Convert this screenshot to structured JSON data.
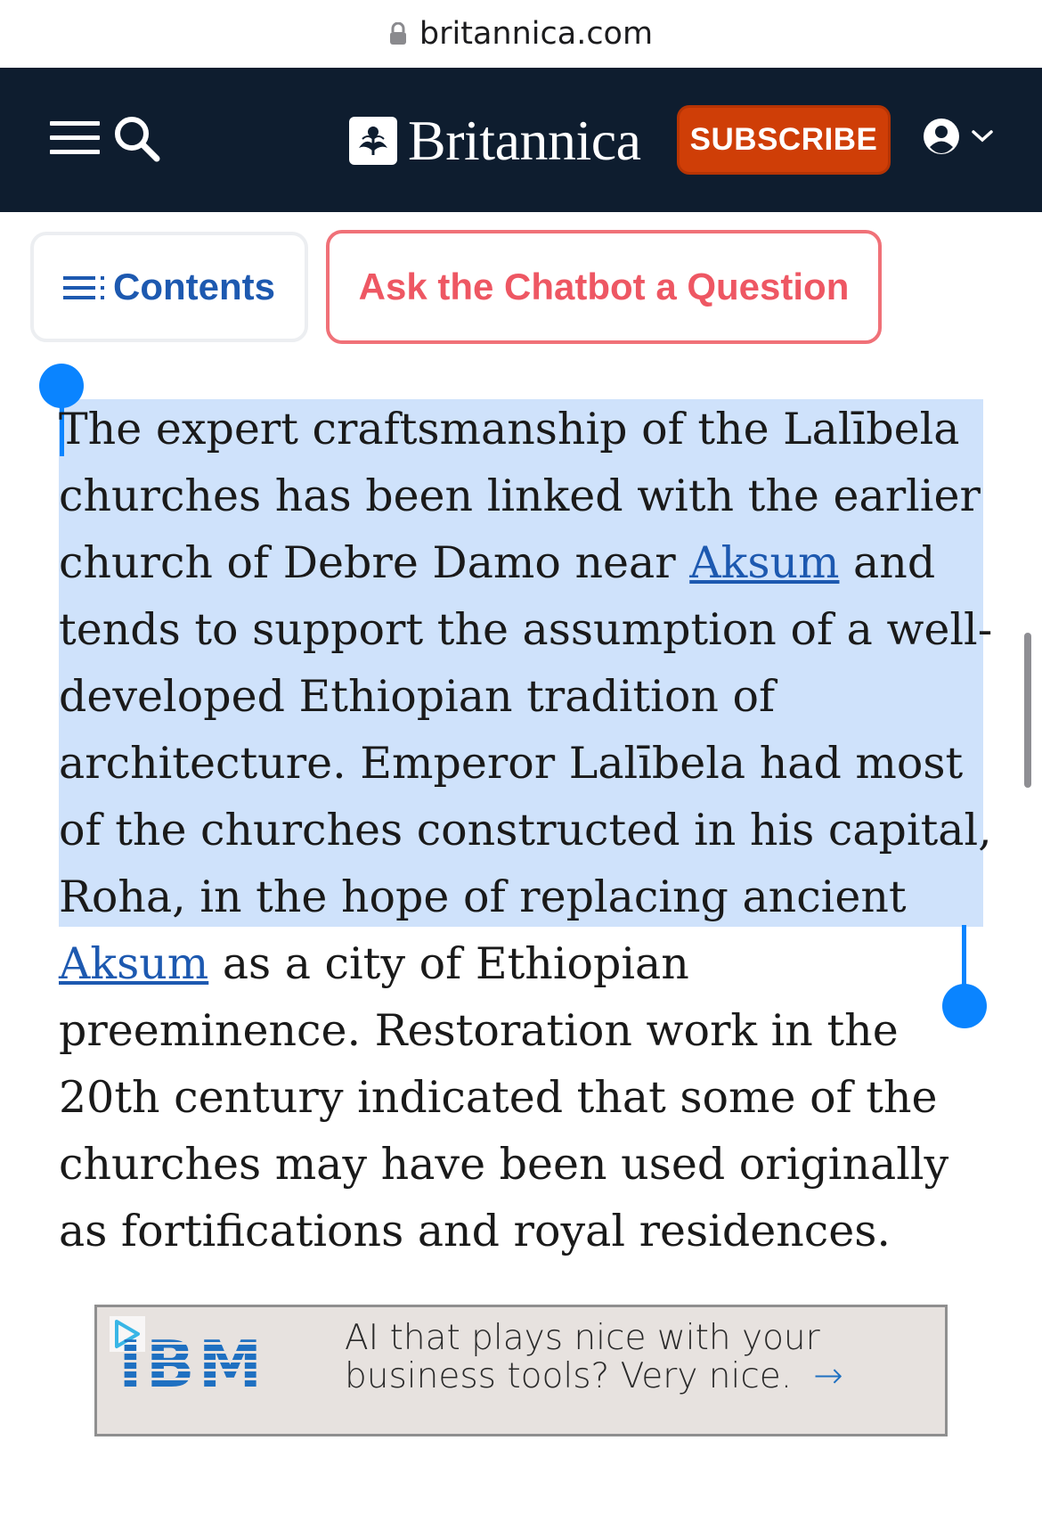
{
  "browser": {
    "url": "britannica.com"
  },
  "header": {
    "brand": "Britannica",
    "subscribe_label": "SUBSCRIBE"
  },
  "toolbar": {
    "contents_label": "Contents",
    "chatbot_label": "Ask the Chatbot a Question"
  },
  "article": {
    "p1_a": "The expert craftsmanship of the Lalībela churches has been linked with the earlier church of Debre Damo near ",
    "link1": "Aksum",
    "p1_b": " and tends to support the assumption of a well-developed Ethiopian tradition of architecture. Emperor Lalībela had most of the churches constructed in his capital, Roha, in the hope of replacing ancient ",
    "link2": "Aksum",
    "p1_c": " as a city of Ethiopian preeminence.",
    "p1_d": " Restoration work in the 20th century indicated that some of the churches may have been used originally as fortifications and royal residences."
  },
  "ad": {
    "brand": "IBM",
    "text": "AI that plays nice with your business tools? Very nice."
  },
  "colors": {
    "header_bg": "#0e1d2f",
    "subscribe_bg": "#cf3e07",
    "link": "#1d59b0",
    "chatbot_accent": "#ee5763",
    "selection": "#c5dcf7"
  },
  "icons": [
    "lock-icon",
    "menu-icon",
    "search-icon",
    "britannica-logo-icon",
    "account-icon",
    "chevron-down-icon",
    "contents-list-icon",
    "ad-play-icon",
    "arrow-right-icon"
  ]
}
